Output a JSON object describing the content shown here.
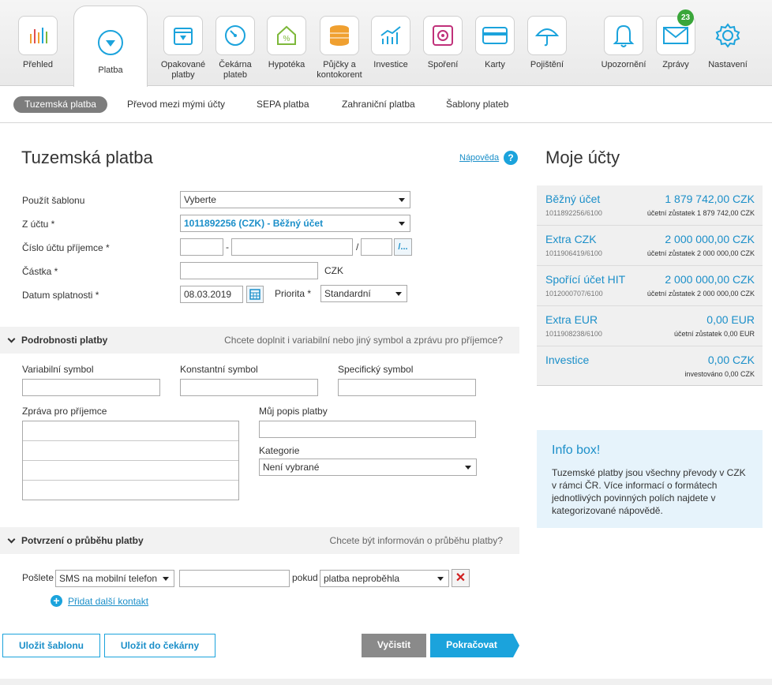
{
  "nav": {
    "items": [
      {
        "label": "Přehled"
      },
      {
        "label": "Platba"
      },
      {
        "label": "Opakované platby"
      },
      {
        "label": "Čekárna plateb"
      },
      {
        "label": "Hypotéka"
      },
      {
        "label": "Půjčky a kontokorent"
      },
      {
        "label": "Investice"
      },
      {
        "label": "Spoření"
      },
      {
        "label": "Karty"
      },
      {
        "label": "Pojištění"
      },
      {
        "label": "Upozornění"
      },
      {
        "label": "Zprávy",
        "badge": "23"
      },
      {
        "label": "Nastavení"
      }
    ]
  },
  "subnav": {
    "tabs": [
      "Tuzemská platba",
      "Převod mezi mými účty",
      "SEPA platba",
      "Zahraniční platba",
      "Šablony plateb"
    ]
  },
  "form": {
    "title": "Tuzemská platba",
    "help": "Nápověda",
    "template_label": "Použít šablonu",
    "template_value": "Vyberte",
    "from_label": "Z účtu *",
    "from_value": "1011892256 (CZK) - Běžný účet",
    "recipient_label": "Číslo účtu příjemce *",
    "dash": "-",
    "slash": "/",
    "bank_btn": "/...",
    "amount_label": "Částka *",
    "currency": "CZK",
    "due_label": "Datum splatnosti *",
    "due_value": "08.03.2019",
    "priority_label": "Priorita *",
    "priority_value": "Standardní"
  },
  "details": {
    "title": "Podrobnosti platby",
    "hint": "Chcete doplnit i variabilní nebo jiný symbol a zprávu pro příjemce?",
    "vs_label": "Variabilní symbol",
    "ks_label": "Konstantní symbol",
    "ss_label": "Specifický symbol",
    "msg_label": "Zpráva pro příjemce",
    "desc_label": "Můj popis platby",
    "category_label": "Kategorie",
    "category_value": "Není vybrané"
  },
  "confirm": {
    "title": "Potvrzení o průběhu platby",
    "hint": "Chcete být informován o průběhu platby?",
    "send_label": "Pošlete",
    "channel_value": "SMS na mobilní telefon",
    "if_label": "pokud",
    "condition_value": "platba neproběhla",
    "add_contact": "Přidat další kontakt"
  },
  "buttons": {
    "save_template": "Uložit šablonu",
    "save_waiting": "Uložit do čekárny",
    "clear": "Vyčistit",
    "continue": "Pokračovat"
  },
  "accounts": {
    "title": "Moje účty",
    "items": [
      {
        "name": "Běžný účet",
        "amount": "1 879 742,00 CZK",
        "number": "1011892256/6100",
        "balance": "účetní zůstatek 1 879 742,00 CZK"
      },
      {
        "name": "Extra CZK",
        "amount": "2 000 000,00 CZK",
        "number": "1011906419/6100",
        "balance": "účetní zůstatek 2 000 000,00 CZK"
      },
      {
        "name": "Spořící účet HIT",
        "amount": "2 000 000,00 CZK",
        "number": "1012000707/6100",
        "balance": "účetní zůstatek 2 000 000,00 CZK"
      },
      {
        "name": "Extra EUR",
        "amount": "0,00 EUR",
        "number": "1011908238/6100",
        "balance": "účetní zůstatek 0,00 EUR"
      },
      {
        "name": "Investice",
        "amount": "0,00 CZK",
        "number": "",
        "balance": "investováno 0,00 CZK"
      }
    ]
  },
  "info": {
    "title": "Info box!",
    "text": "Tuzemské platby jsou všechny převody v CZK v rámci ČR. Více informací o formátech jednotlivých povinných polích najdete v kategorizované nápovědě."
  },
  "colors": {
    "accent": "#1ba3dc",
    "link": "#1b8fc9",
    "badge": "#3aa63a"
  }
}
